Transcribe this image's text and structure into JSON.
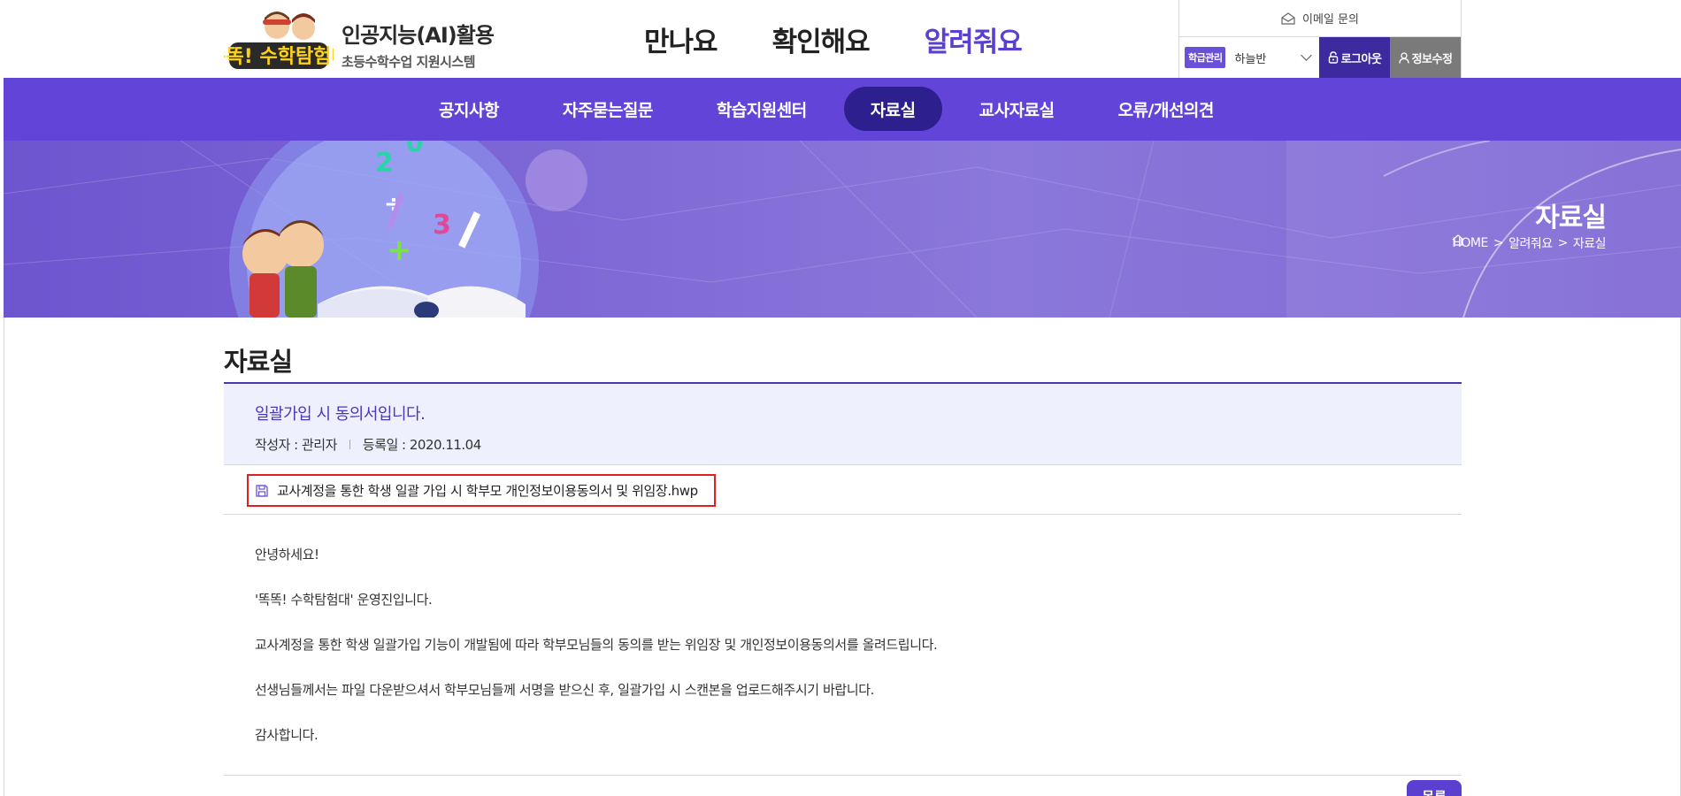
{
  "header": {
    "logo_text": "똑똑! 수학탐험대",
    "site_title": "인공지능(AI)활용",
    "site_subtitle": "초등수학수업 지원시스템",
    "main_nav": [
      "만나요",
      "확인해요",
      "알려줘요"
    ],
    "util": {
      "email_label": "이메일 문의",
      "badge": "학급관리",
      "class_name": "하늘반",
      "logout": "로그아웃",
      "edit_info": "정보수정"
    }
  },
  "sub_nav": [
    "공지사항",
    "자주묻는질문",
    "학습지원센터",
    "자료실",
    "교사자료실",
    "오류/개선의견"
  ],
  "banner": {
    "title": "자료실",
    "breadcrumb": [
      "HOME",
      "알려줘요",
      "자료실"
    ],
    "breadcrumb_sep": ">"
  },
  "page": {
    "heading": "자료실",
    "post": {
      "title": "일괄가입 시 동의서입니다.",
      "author": "작성자 : 관리자",
      "date": "등록일 : 2020.11.04",
      "attachment": "교사계정을 통한 학생 일괄 가입 시 학부모 개인정보이용동의서 및 위임장.hwp",
      "body": [
        "안녕하세요!",
        "'똑똑! 수학탐험대' 운영진입니다.",
        "교사계정을 통한 학생 일괄가입 기능이 개발됨에 따라 학부모님들의 동의를 받는 위임장 및 개인정보이용동의서를 올려드립니다.",
        "선생님들께서는 파일 다운받으셔서 학부모님들께 서명을 받으신 후, 일괄가입 시 스캔본을 업로드해주시기 바랍니다.",
        "감사합니다."
      ]
    },
    "list_button": "목록"
  },
  "colors": {
    "primary": "#6245d8",
    "primary_dark": "#2e1f8f",
    "active_menu": "#5b3fd0",
    "attachment_highlight": "#e02020"
  }
}
